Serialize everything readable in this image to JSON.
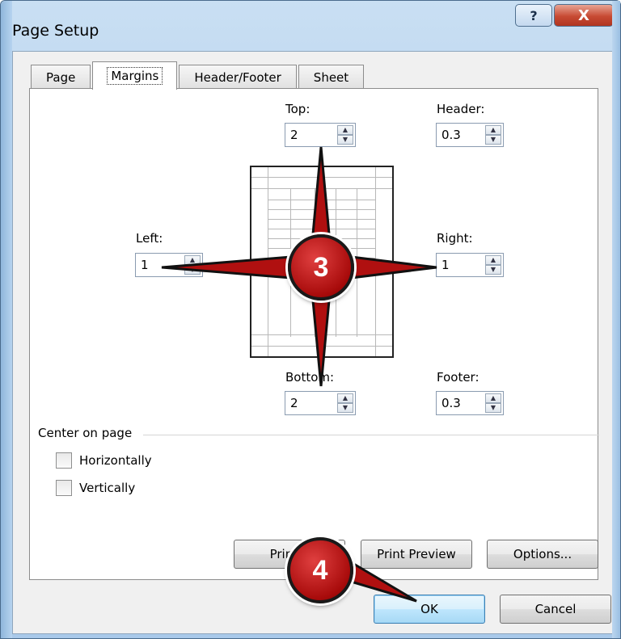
{
  "window": {
    "title": "Page Setup",
    "help_glyph": "?",
    "close_glyph": "X"
  },
  "tabs": [
    {
      "label": "Page",
      "active": false
    },
    {
      "label": "Margins",
      "active": true
    },
    {
      "label": "Header/Footer",
      "active": false
    },
    {
      "label": "Sheet",
      "active": false
    }
  ],
  "margins": {
    "top": {
      "label": "Top:",
      "value": "2"
    },
    "header": {
      "label": "Header:",
      "value": "0.3"
    },
    "left": {
      "label": "Left:",
      "value": "1"
    },
    "right": {
      "label": "Right:",
      "value": "1"
    },
    "bottom": {
      "label": "Bottom:",
      "value": "2"
    },
    "footer": {
      "label": "Footer:",
      "value": "0.3"
    }
  },
  "center_on_page": {
    "heading": "Center on page",
    "horizontally": {
      "label": "Horizontally",
      "checked": false
    },
    "vertically": {
      "label": "Vertically",
      "checked": false
    }
  },
  "buttons": {
    "print": "Print...",
    "print_preview": "Print Preview",
    "options": "Options...",
    "ok": "OK",
    "cancel": "Cancel"
  },
  "callouts": {
    "step3": "3",
    "step4": "4",
    "color": "#b01010"
  }
}
